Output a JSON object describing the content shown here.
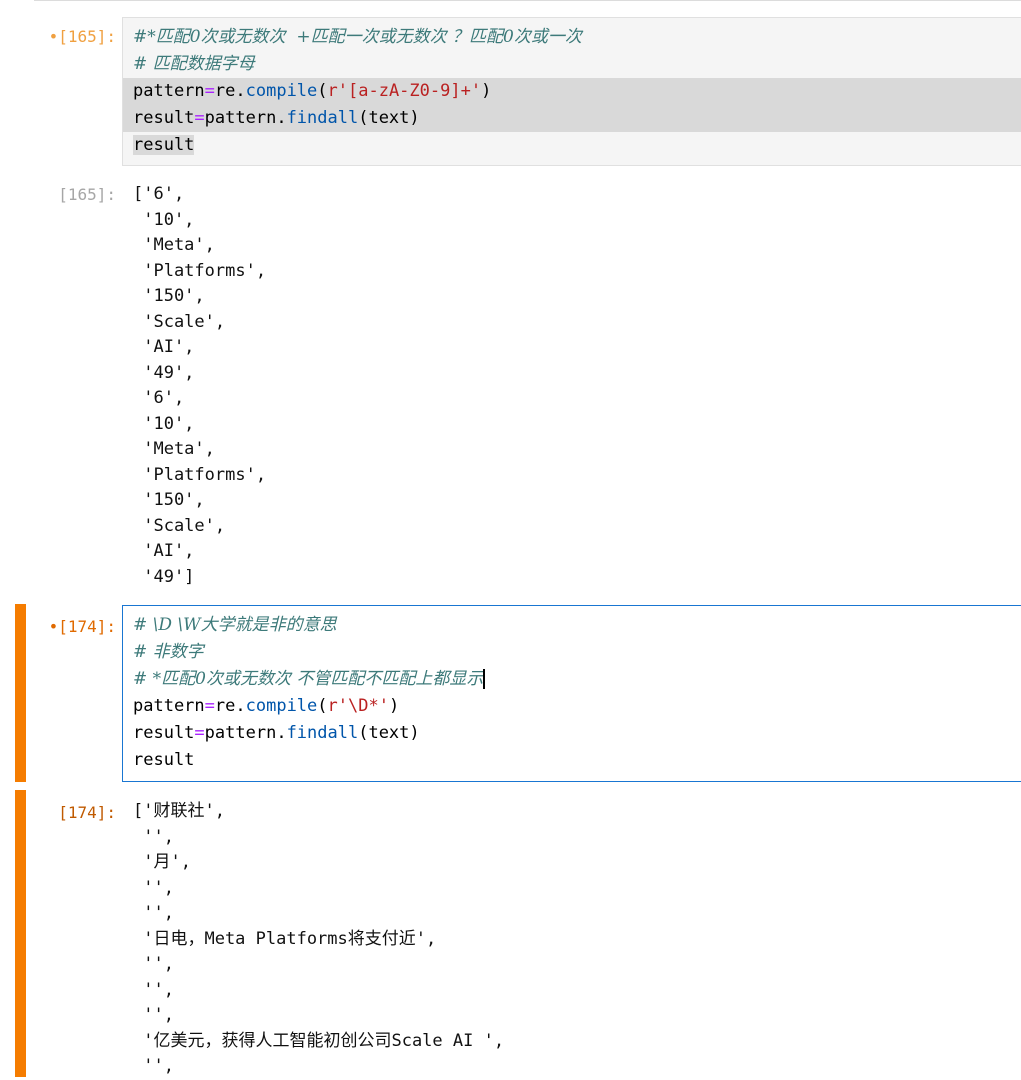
{
  "cells": [
    {
      "in_prompt": "•[165]:",
      "out_prompt": "[165]:",
      "code": {
        "comment1": "#*匹配0次或无数次  +匹配一次或无数次 ？匹配0次或一次",
        "comment2": "# 匹配数据字母",
        "l3_var": "pattern",
        "l3_eq": "=",
        "l3_mod": "re.",
        "l3_fn": "compile",
        "l3_open": "(",
        "l3_str": "r'[a-zA-Z0-9]+'",
        "l3_close": ")",
        "l4_var": "result",
        "l4_eq": "=",
        "l4_obj": "pattern.",
        "l4_fn": "findall",
        "l4_args": "(text)",
        "l5": "result"
      },
      "output_lines": [
        "['6',",
        " '10',",
        " 'Meta',",
        " 'Platforms',",
        " '150',",
        " 'Scale',",
        " 'AI',",
        " '49',",
        " '6',",
        " '10',",
        " 'Meta',",
        " 'Platforms',",
        " '150',",
        " 'Scale',",
        " 'AI',",
        " '49']"
      ]
    },
    {
      "in_prompt": "•[174]:",
      "out_prompt": "[174]:",
      "code": {
        "comment1": "# \\D \\W大学就是非的意思",
        "comment2": "# 非数字",
        "comment3": "# *匹配0次或无数次 不管匹配不匹配上都显示",
        "l4_var": "pattern",
        "l4_eq": "=",
        "l4_mod": "re.",
        "l4_fn": "compile",
        "l4_open": "(",
        "l4_str": "r'\\D*'",
        "l4_close": ")",
        "l5_var": "result",
        "l5_eq": "=",
        "l5_obj": "pattern.",
        "l5_fn": "findall",
        "l5_args": "(text)",
        "l6": "result"
      },
      "output_lines": [
        "['财联社',",
        " '',",
        " '月',",
        " '',",
        " '',",
        " '日电，Meta Platforms将支付近',",
        " '',",
        " '',",
        " '',",
        " '亿美元，获得人工智能初创公司Scale AI ',",
        " '',"
      ]
    }
  ]
}
